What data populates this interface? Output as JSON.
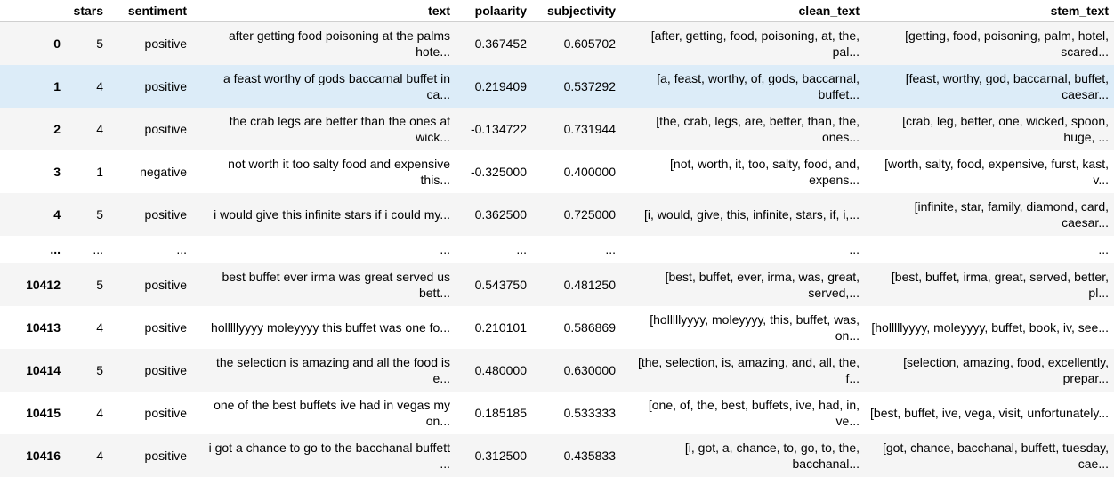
{
  "columns": [
    "",
    "stars",
    "sentiment",
    "text",
    "polaarity",
    "subjectivity",
    "clean_text",
    "stem_text"
  ],
  "rows": [
    {
      "index": "0",
      "stars": "5",
      "sentiment": "positive",
      "text": "after getting food poisoning at the palms hote...",
      "polarity": "0.367452",
      "subjectivity": "0.605702",
      "clean_text": "[after, getting, food, poisoning, at, the, pal...",
      "stem_text": "[getting, food, poisoning, palm, hotel, scared..."
    },
    {
      "index": "1",
      "stars": "4",
      "sentiment": "positive",
      "text": "a feast worthy of gods baccarnal buffet in ca...",
      "polarity": "0.219409",
      "subjectivity": "0.537292",
      "clean_text": "[a, feast, worthy, of, gods, baccarnal, buffet...",
      "stem_text": "[feast, worthy, god, baccarnal, buffet, caesar..."
    },
    {
      "index": "2",
      "stars": "4",
      "sentiment": "positive",
      "text": "the crab legs are better than the ones at wick...",
      "polarity": "-0.134722",
      "subjectivity": "0.731944",
      "clean_text": "[the, crab, legs, are, better, than, the, ones...",
      "stem_text": "[crab, leg, better, one, wicked, spoon, huge, ..."
    },
    {
      "index": "3",
      "stars": "1",
      "sentiment": "negative",
      "text": "not worth it too salty food and expensive this...",
      "polarity": "-0.325000",
      "subjectivity": "0.400000",
      "clean_text": "[not, worth, it, too, salty, food, and, expens...",
      "stem_text": "[worth, salty, food, expensive, furst, kast, v..."
    },
    {
      "index": "4",
      "stars": "5",
      "sentiment": "positive",
      "text": "i would give this infinite stars if i could my...",
      "polarity": "0.362500",
      "subjectivity": "0.725000",
      "clean_text": "[i, would, give, this, infinite, stars, if, i,...",
      "stem_text": "[infinite, star, family, diamond, card, caesar..."
    },
    {
      "index": "...",
      "stars": "...",
      "sentiment": "...",
      "text": "...",
      "polarity": "...",
      "subjectivity": "...",
      "clean_text": "...",
      "stem_text": "..."
    },
    {
      "index": "10412",
      "stars": "5",
      "sentiment": "positive",
      "text": "best buffet ever irma was great served us bett...",
      "polarity": "0.543750",
      "subjectivity": "0.481250",
      "clean_text": "[best, buffet, ever, irma, was, great, served,...",
      "stem_text": "[best, buffet, irma, great, served, better, pl..."
    },
    {
      "index": "10413",
      "stars": "4",
      "sentiment": "positive",
      "text": "holllllyyyy moleyyyy this buffet was one fo...",
      "polarity": "0.210101",
      "subjectivity": "0.586869",
      "clean_text": "[holllllyyyy, moleyyyy, this, buffet, was, on...",
      "stem_text": "[holllllyyyy, moleyyyy, buffet, book, iv, see..."
    },
    {
      "index": "10414",
      "stars": "5",
      "sentiment": "positive",
      "text": "the selection is amazing and all the food is e...",
      "polarity": "0.480000",
      "subjectivity": "0.630000",
      "clean_text": "[the, selection, is, amazing, and, all, the, f...",
      "stem_text": "[selection, amazing, food, excellently, prepar..."
    },
    {
      "index": "10415",
      "stars": "4",
      "sentiment": "positive",
      "text": "one of the best buffets ive had in vegas my on...",
      "polarity": "0.185185",
      "subjectivity": "0.533333",
      "clean_text": "[one, of, the, best, buffets, ive, had, in, ve...",
      "stem_text": "[best, buffet, ive, vega, visit, unfortunately..."
    },
    {
      "index": "10416",
      "stars": "4",
      "sentiment": "positive",
      "text": "i got a chance to go to the bacchanal buffett ...",
      "polarity": "0.312500",
      "subjectivity": "0.435833",
      "clean_text": "[i, got, a, chance, to, go, to, the, bacchanal...",
      "stem_text": "[got, chance, bacchanal, buffett, tuesday, cae..."
    }
  ]
}
